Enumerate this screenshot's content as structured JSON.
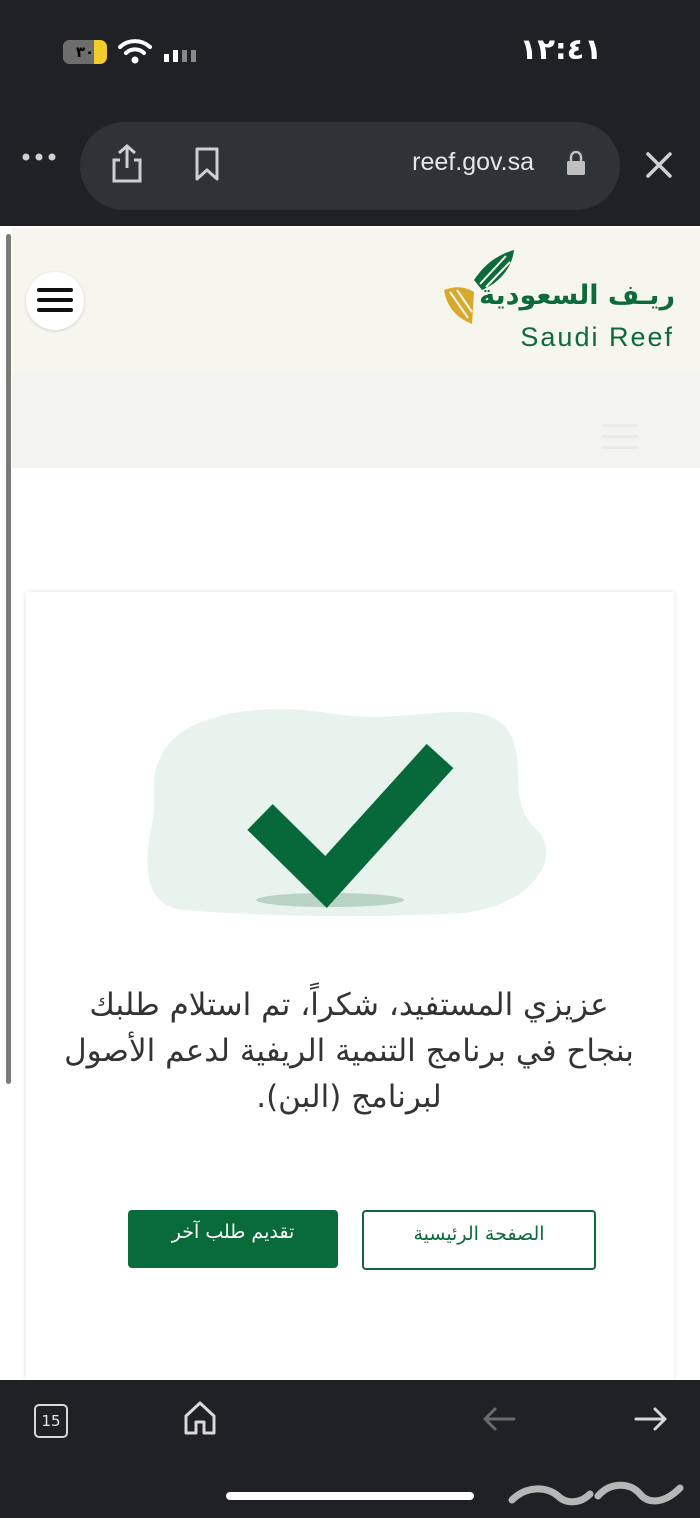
{
  "status_bar": {
    "time": "١٢:٤١",
    "battery": "٣٠",
    "battery_level": 0.3
  },
  "browser": {
    "url": "reef.gov.sa"
  },
  "header": {
    "logo_ar": "ريـف السعودية",
    "logo_en": "Saudi Reef"
  },
  "card": {
    "message": "عزيزي المستفيد، شكراً، تم استلام طلبك بنجاح في برنامج التنمية الريفية لدعم الأصول لبرنامج (البن).",
    "home_button": "الصفحة الرئيسية",
    "new_request_button": "تقديم طلب آخر"
  },
  "toolbar": {
    "tab_count": "15"
  },
  "colors": {
    "brand_green": "#0d6b3b",
    "brand_gold": "#d9a92b",
    "chrome_dark": "#1f2125"
  }
}
